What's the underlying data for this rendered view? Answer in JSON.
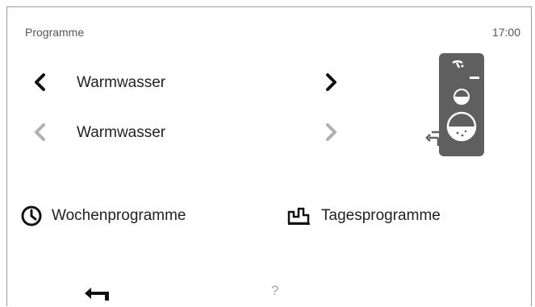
{
  "header": {
    "title": "Programme",
    "time": "17:00"
  },
  "program_rows": [
    {
      "label": "Warmwasser",
      "state": "active"
    },
    {
      "label": "Warmwasser",
      "state": "inactive"
    }
  ],
  "actions": {
    "weekly_label": "Wochenprogramme",
    "daily_label": "Tagesprogramme"
  },
  "footer": {
    "help_label": "?"
  },
  "colors": {
    "active": "#111111",
    "inactive": "#b0b0b0",
    "tank": "#5f5f5f",
    "accent_white": "#ffffff"
  },
  "icons": {
    "week": "clock-icon",
    "day": "day-profile-icon",
    "tank": "hot-water-tank-icon",
    "back": "back-arrow-icon"
  }
}
